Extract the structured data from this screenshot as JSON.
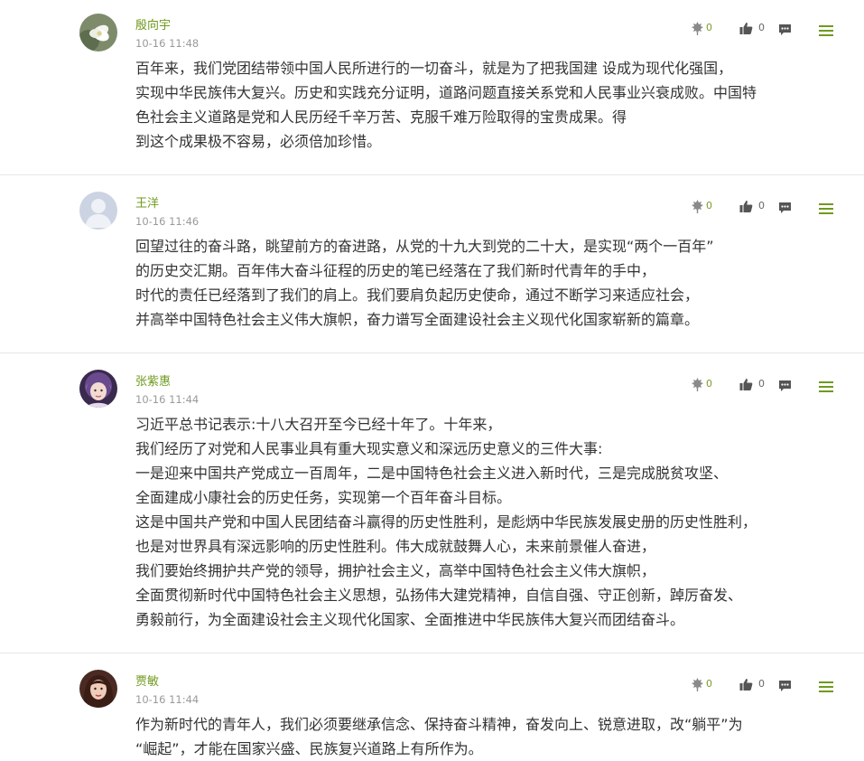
{
  "comments": [
    {
      "author": "殷向宇",
      "time": "10-16 11:48",
      "dislikes": "0",
      "likes": "0",
      "avatar": "flower-avatar",
      "lines": [
        "百年来，我们党团结带领中国人民所进行的一切奋斗，就是为了把我国建 设成为现代化强国，",
        "实现中华民族伟大复兴。历史和实践充分证明，道路问题直接关系党和人民事业兴衰成败。中国特",
        "色社会主义道路是党和人民历经千辛万苦、克服千难万险取得的宝贵成果。得",
        "到这个成果极不容易，必须倍加珍惜。"
      ]
    },
    {
      "author": "王洋",
      "time": "10-16 11:46",
      "dislikes": "0",
      "likes": "0",
      "avatar": "default-user-avatar",
      "lines": [
        "回望过往的奋斗路，眺望前方的奋进路，从党的十九大到党的二十大，是实现“两个一百年”",
        "的历史交汇期。百年伟大奋斗征程的历史的笔已经落在了我们新时代青年的手中，",
        "时代的责任已经落到了我们的肩上。我们要肩负起历史使命，通过不断学习来适应社会，",
        "并高举中国特色社会主义伟大旗帜，奋力谱写全面建设社会主义现代化国家崭新的篇章。"
      ]
    },
    {
      "author": "张紫惠",
      "time": "10-16 11:44",
      "dislikes": "0",
      "likes": "0",
      "avatar": "girl-purple-avatar",
      "lines": [
        "习近平总书记表示:十八大召开至今已经十年了。十年来，",
        "我们经历了对党和人民事业具有重大现实意义和深远历史意义的三件大事:",
        "一是迎来中国共产党成立一百周年，二是中国特色社会主义进入新时代，三是完成脱贫攻坚、",
        "全面建成小康社会的历史任务，实现第一个百年奋斗目标。",
        "这是中国共产党和中国人民团结奋斗赢得的历史性胜利，是彪炳中华民族发展史册的历史性胜利，",
        "也是对世界具有深远影响的历史性胜利。伟大成就鼓舞人心，未来前景催人奋进，",
        "我们要始终拥护共产党的领导，拥护社会主义，高举中国特色社会主义伟大旗帜，",
        "全面贯彻新时代中国特色社会主义思想，弘扬伟大建党精神，自信自强、守正创新，踔厉奋发、",
        "勇毅前行，为全面建设社会主义现代化国家、全面推进中华民族伟大复兴而团结奋斗。"
      ]
    },
    {
      "author": "贾敏",
      "time": "10-16 11:44",
      "dislikes": "0",
      "likes": "0",
      "avatar": "girl-portrait-avatar",
      "lines": [
        "作为新时代的青年人，我们必须要继承信念、保持奋斗精神，奋发向上、锐意进取，改“躺平”为",
        "“崛起”，才能在国家兴盛、民族复兴道路上有所作为。"
      ]
    }
  ],
  "icons": {
    "dislike": "dislike-icon",
    "like": "thumbs-up-icon",
    "reply": "reply-comment-icon",
    "menu": "menu-icon"
  },
  "colors": {
    "accent": "#6f9a1f",
    "text": "#333333",
    "meta": "#9a9a9a",
    "divider": "#e6e6e6"
  }
}
